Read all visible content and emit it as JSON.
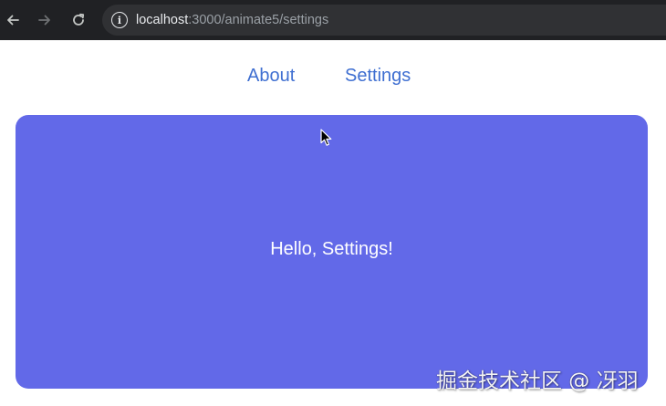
{
  "browser": {
    "url_host": "localhost",
    "url_path": ":3000/animate5/settings",
    "icons": {
      "back": "arrow-left-icon",
      "forward": "arrow-right-icon",
      "reload": "reload-icon",
      "site_info": "info-icon"
    }
  },
  "nav": {
    "items": [
      {
        "label": "About"
      },
      {
        "label": "Settings"
      }
    ],
    "link_color": "#3f6fd1"
  },
  "main": {
    "message": "Hello, Settings!",
    "panel_color": "#6269e8"
  },
  "watermark": {
    "text": "掘金技术社区 @ 冴羽"
  }
}
